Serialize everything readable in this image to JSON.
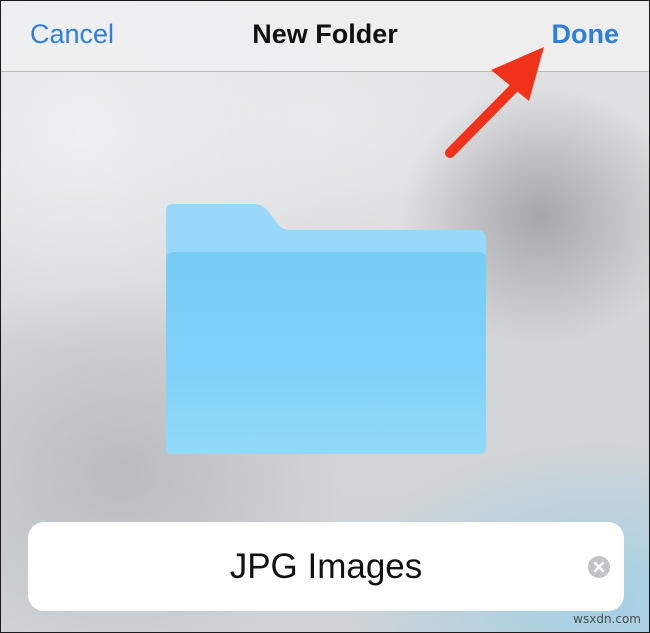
{
  "navbar": {
    "cancel_label": "Cancel",
    "title": "New Folder",
    "done_label": "Done"
  },
  "folder": {
    "icon": "folder-icon",
    "color": "#7ccff7"
  },
  "name_field": {
    "value": "JPG Images",
    "clear_icon": "clear-text-icon"
  },
  "annotation": {
    "icon": "red-arrow-icon",
    "color": "#f0321b"
  },
  "watermark": "wsxdn.com",
  "colors": {
    "accent": "#2d7fd9"
  }
}
